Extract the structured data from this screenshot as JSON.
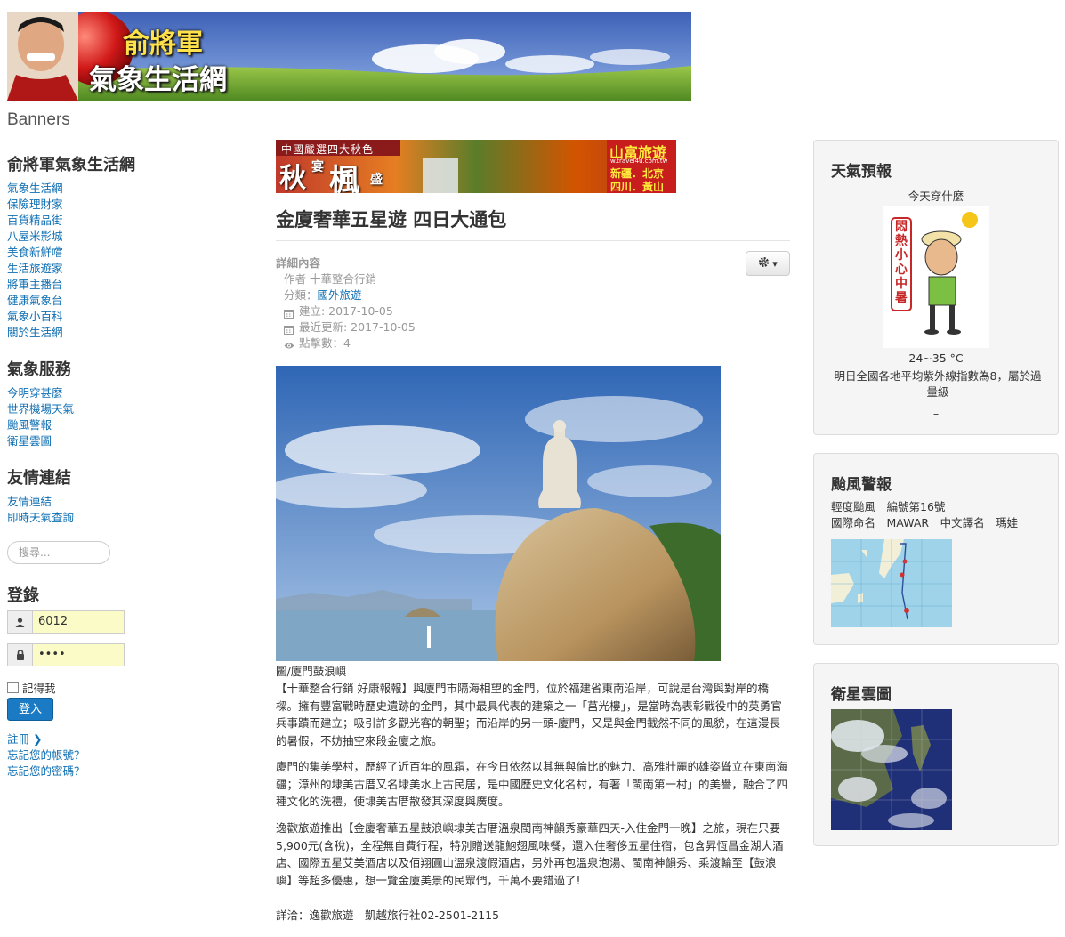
{
  "header": {
    "title_line1": "俞將軍",
    "title_line2": "氣象生活網"
  },
  "banners_label": "Banners",
  "sidebar": {
    "site_section": {
      "heading": "俞將軍氣象生活網",
      "items": [
        "氣象生活網",
        "保險理財家",
        "百貨精品街",
        "八屋米影城",
        "美食新鮮嚐",
        "生活旅遊家",
        "將軍主播台",
        "健康氣象台",
        "氣象小百科",
        "關於生活網"
      ]
    },
    "weather_section": {
      "heading": "氣象服務",
      "items": [
        "今明穿甚麼",
        "世界機場天氣",
        "颱風警報",
        "衛星雲圖"
      ]
    },
    "links_section": {
      "heading": "友情連結",
      "items": [
        "友情連結",
        "即時天氣查詢"
      ]
    },
    "search": {
      "placeholder": "搜尋..."
    },
    "login": {
      "heading": "登錄",
      "username": "6012",
      "password": "••••",
      "remember_label": "記得我",
      "submit_label": "登入",
      "register_label": "註冊",
      "forgot_username": "忘記您的帳號？",
      "forgot_password": "忘記您的密碼？"
    }
  },
  "ad": {
    "top_text": "中國嚴選四大秋色",
    "main_text1": "秋",
    "main_text2": "宴",
    "main_text3": "楓",
    "main_text4": "盛",
    "brand": "山富旅遊",
    "url": "w.travel4u.com.tw",
    "dest1": "新疆．北京",
    "dest2": "四川．黃山"
  },
  "article": {
    "title": "金廈奢華五星遊 四日大通包",
    "details_label": "詳細內容",
    "author": "作者 十華整合行銷",
    "category_label": "分類：",
    "category_value": "國外旅遊",
    "created": "建立: 2017-10-05",
    "updated": "最近更新: 2017-10-05",
    "hits": "點擊數：4",
    "photo_caption": "圖/廈門鼓浪嶼",
    "paragraphs": [
      "【十華整合行銷 好康報報】與廈門市隔海相望的金門，位於福建省東南沿岸，可說是台灣與對岸的橋樑。擁有豐富戰時歷史遺跡的金門，其中最具代表的建築之一「莒光樓」，是當時為表彰戰役中的英勇官兵事蹟而建立；吸引許多觀光客的朝聖；而沿岸的另一頭-廈門，又是與金門截然不同的風貌，在這漫長的暑假，不妨抽空來段金廈之旅。",
      "廈門的集美學村，歷經了近百年的風霜，在今日依然以其無與倫比的魅力、高雅壯麗的雄姿聳立在東南海疆；漳州的埭美古厝又名埭美水上古民居，是中國歷史文化名村，有著「閩南第一村」的美譽，融合了四種文化的洗禮，使埭美古厝散發其深度與廣度。",
      "逸歡旅遊推出【金廈奢華五星鼓浪嶼埭美古厝溫泉閩南神韻秀豪華四天-入住金門一晚】之旅，現在只要5,900元(含稅)，全程無自費行程，特別贈送龍鮑翅風味餐，還入住奢侈五星住宿，包含昇恆昌金湖大酒店、國際五星艾美酒店以及佰翔圓山溫泉渡假酒店，另外再包溫泉泡湯、閩南神韻秀、乘渡輪至【鼓浪嶼】等超多優惠，想一覽金廈美景的民眾們，千萬不要錯過了!",
      "詳洽：逸歡旅遊　凱越旅行社02-2501-2115"
    ]
  },
  "weather_module": {
    "heading": "天氣預報",
    "subtitle": "今天穿什麼",
    "badge_text": "悶熱小心中暑",
    "temp": "24~35 °C",
    "uv_text": "明日全國各地平均紫外線指數為8，屬於過量級",
    "dash": "–"
  },
  "typhoon_module": {
    "heading": "颱風警報",
    "line1": "輕度颱風　編號第16號",
    "line2": "國際命名　MAWAR　中文譯名　瑪娃"
  },
  "satellite_module": {
    "heading": "衛星雲圖"
  }
}
